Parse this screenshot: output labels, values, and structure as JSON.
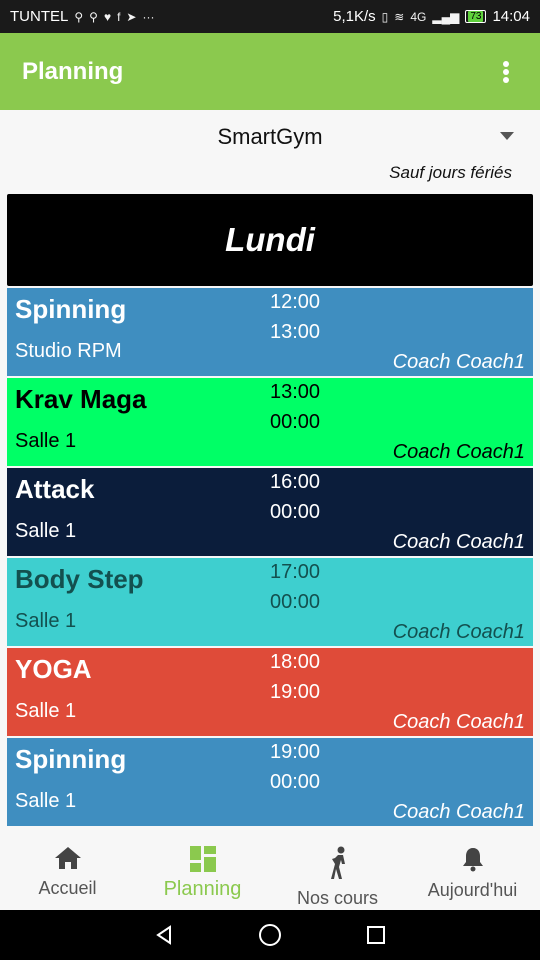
{
  "status_bar": {
    "carrier": "TUNTEL",
    "speed": "5,1K/s",
    "network": "4G",
    "battery": "73",
    "time": "14:04"
  },
  "app_bar": {
    "title": "Planning"
  },
  "gym_select": {
    "value": "SmartGym"
  },
  "holiday_note": "Sauf jours fériés",
  "day": "Lundi",
  "sessions": [
    {
      "name": "Spinning",
      "room": "Studio RPM",
      "start": "12:00",
      "end": "13:00",
      "coach": "Coach Coach1",
      "bg": "#3f8ec0",
      "fg": "#ffffff"
    },
    {
      "name": "Krav Maga",
      "room": "Salle 1",
      "start": "13:00",
      "end": "00:00",
      "coach": "Coach Coach1",
      "bg": "#00ff66",
      "fg": "#000000"
    },
    {
      "name": "Attack",
      "room": "Salle 1",
      "start": "16:00",
      "end": "00:00",
      "coach": "Coach Coach1",
      "bg": "#0b1d3b",
      "fg": "#ffffff"
    },
    {
      "name": "Body Step",
      "room": "Salle 1",
      "start": "17:00",
      "end": "00:00",
      "coach": "Coach Coach1",
      "bg": "#3ecfcf",
      "fg": "#13504f"
    },
    {
      "name": "YOGA",
      "room": "Salle 1",
      "start": "18:00",
      "end": "19:00",
      "coach": "Coach Coach1",
      "bg": "#df4b39",
      "fg": "#ffffff"
    },
    {
      "name": "Spinning",
      "room": "Salle 1",
      "start": "19:00",
      "end": "00:00",
      "coach": "Coach Coach1",
      "bg": "#3f8ec0",
      "fg": "#ffffff"
    }
  ],
  "bottom_nav": [
    {
      "label": "Accueil",
      "icon": "home-icon",
      "active": false
    },
    {
      "label": "Planning",
      "icon": "grid-icon",
      "active": true
    },
    {
      "label": "Nos cours",
      "icon": "exercise-person-icon",
      "active": false
    },
    {
      "label": "Aujourd'hui",
      "icon": "bell-icon",
      "active": false
    }
  ],
  "colors": {
    "accent": "#8bc94e",
    "day_header_bg": "#000000"
  }
}
